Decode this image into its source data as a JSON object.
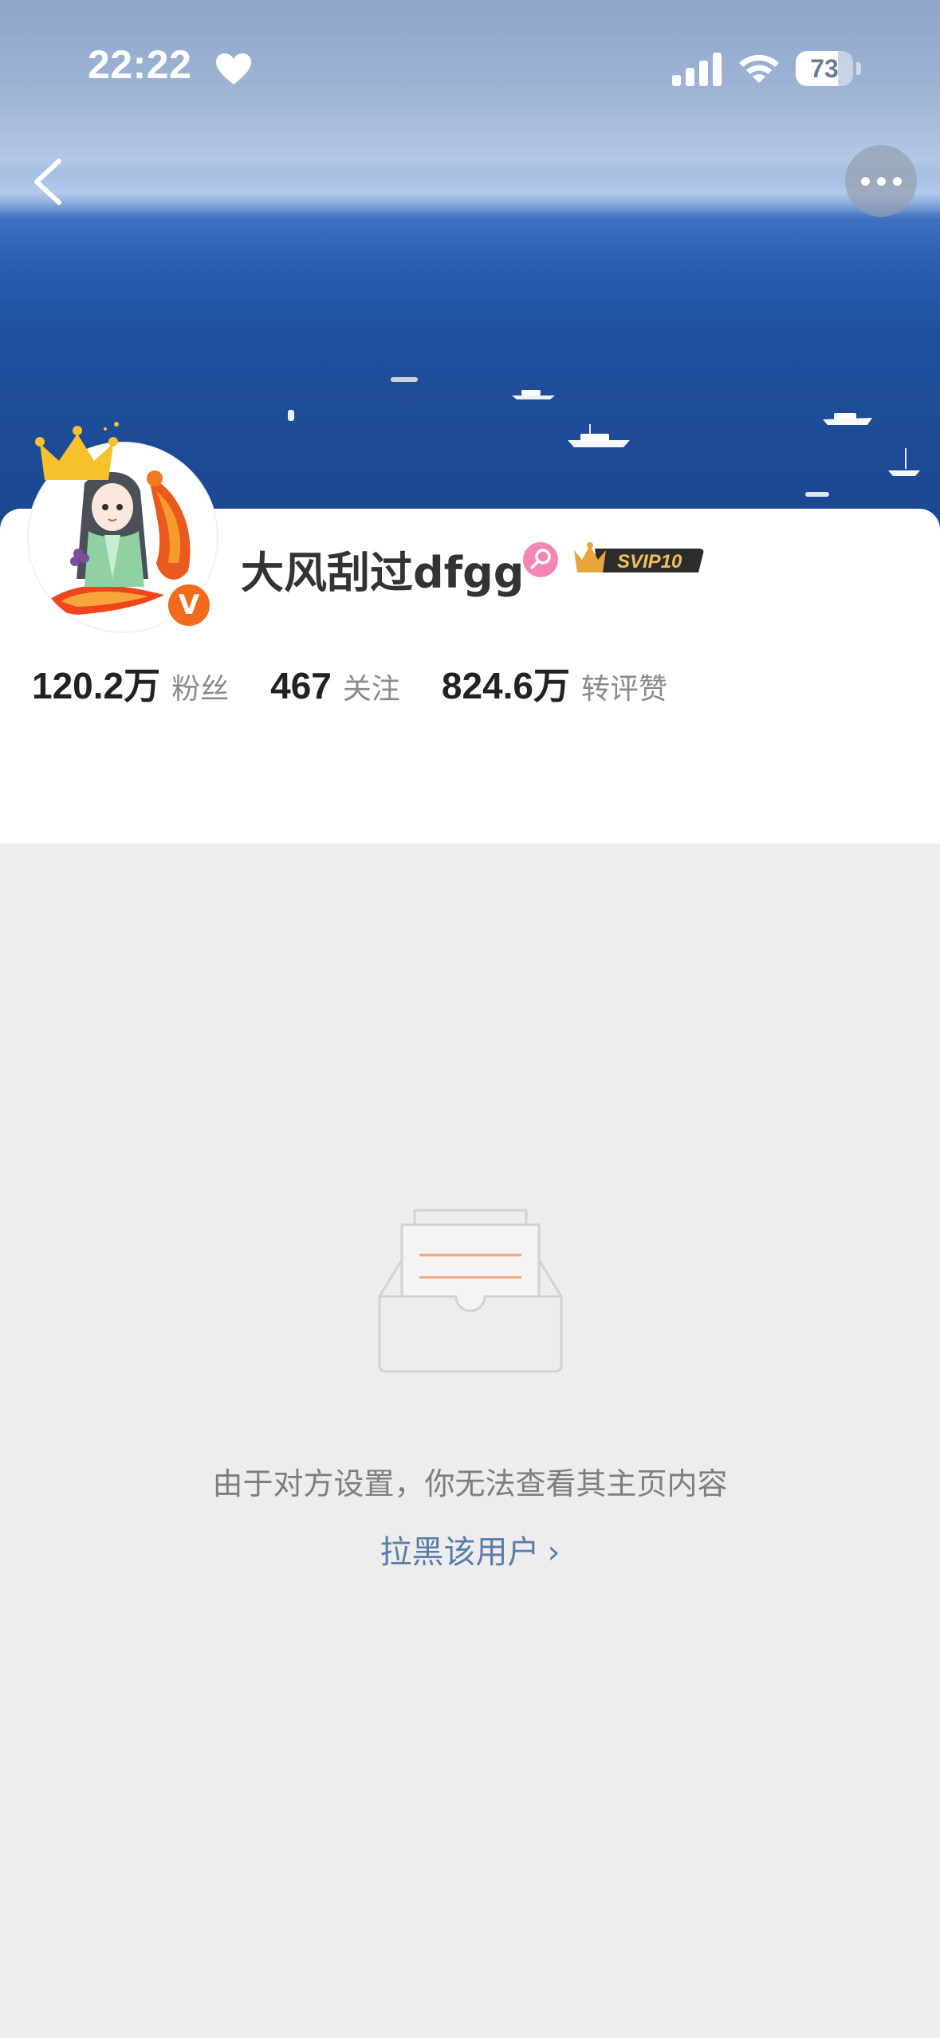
{
  "status_bar": {
    "time": "22:22",
    "battery": "73",
    "battery_level": 0.73
  },
  "profile": {
    "username": "大风刮过dfgg",
    "vip_badge": "SVIP10",
    "gender_icon": "female-icon",
    "verified_badge": "V",
    "stats": [
      {
        "value": "120.2万",
        "label": "粉丝"
      },
      {
        "value": "467",
        "label": "关注"
      },
      {
        "value": "824.6万",
        "label": "转评赞"
      }
    ]
  },
  "empty_state": {
    "message": "由于对方设置，你无法查看其主页内容",
    "block_link": "拉黑该用户",
    "block_chevron": "›"
  },
  "colors": {
    "accent_orange": "#f26a1b",
    "link_blue": "#5a7cab",
    "background": "#ededed"
  }
}
